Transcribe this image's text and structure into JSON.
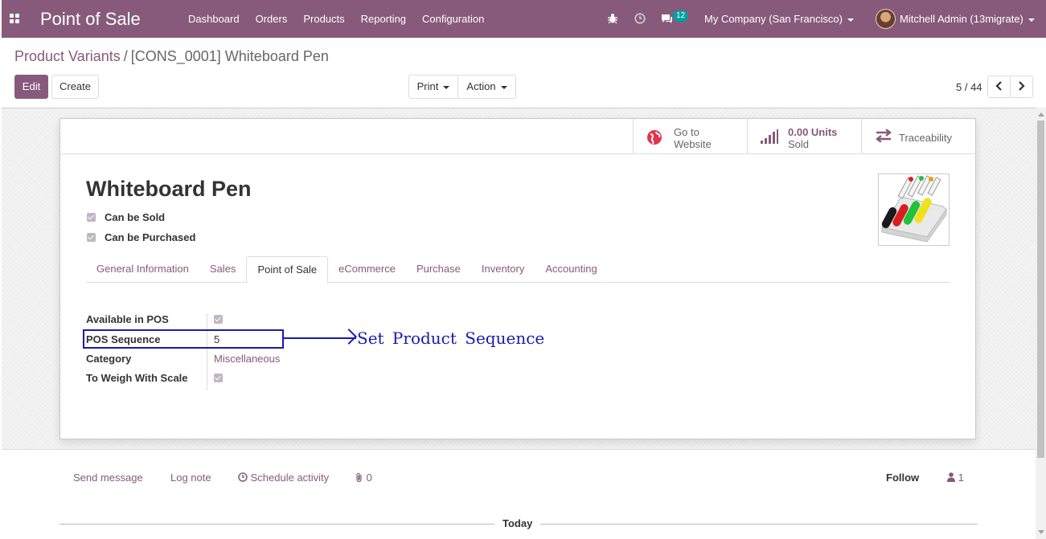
{
  "navbar": {
    "brand": "Point of Sale",
    "menu": [
      "Dashboard",
      "Orders",
      "Products",
      "Reporting",
      "Configuration"
    ],
    "chat_count": "12",
    "company": "My Company (San Francisco)",
    "user": "Mitchell Admin (13migrate)"
  },
  "breadcrumb": {
    "parent": "Product Variants",
    "separator": "/",
    "current": "[CONS_0001] Whiteboard Pen"
  },
  "toolbar": {
    "edit": "Edit",
    "create": "Create",
    "print": "Print",
    "action": "Action",
    "pager": "5 / 44"
  },
  "stat_buttons": {
    "website_line1": "Go to",
    "website_line2": "Website",
    "sold_value": "0.00 Units",
    "sold_label": "Sold",
    "traceability": "Traceability"
  },
  "product": {
    "name": "Whiteboard Pen",
    "can_be_sold": "Can be Sold",
    "can_be_purchased": "Can be Purchased"
  },
  "tabs": [
    "General Information",
    "Sales",
    "Point of Sale",
    "eCommerce",
    "Purchase",
    "Inventory",
    "Accounting"
  ],
  "pos_fields": {
    "available_label": "Available in POS",
    "sequence_label": "POS Sequence",
    "sequence_value": "5",
    "category_label": "Category",
    "category_value": "Miscellaneous",
    "weigh_label": "To Weigh With Scale"
  },
  "annotation": "Set Product Sequence",
  "chatter": {
    "send_message": "Send message",
    "log_note": "Log note",
    "schedule_activity": "Schedule activity",
    "attachments": "0",
    "follow": "Follow",
    "followers": "1",
    "today": "Today"
  },
  "colors": {
    "brand": "#875a7b",
    "annotation": "#1a1ab0",
    "badge": "#00a09d"
  }
}
